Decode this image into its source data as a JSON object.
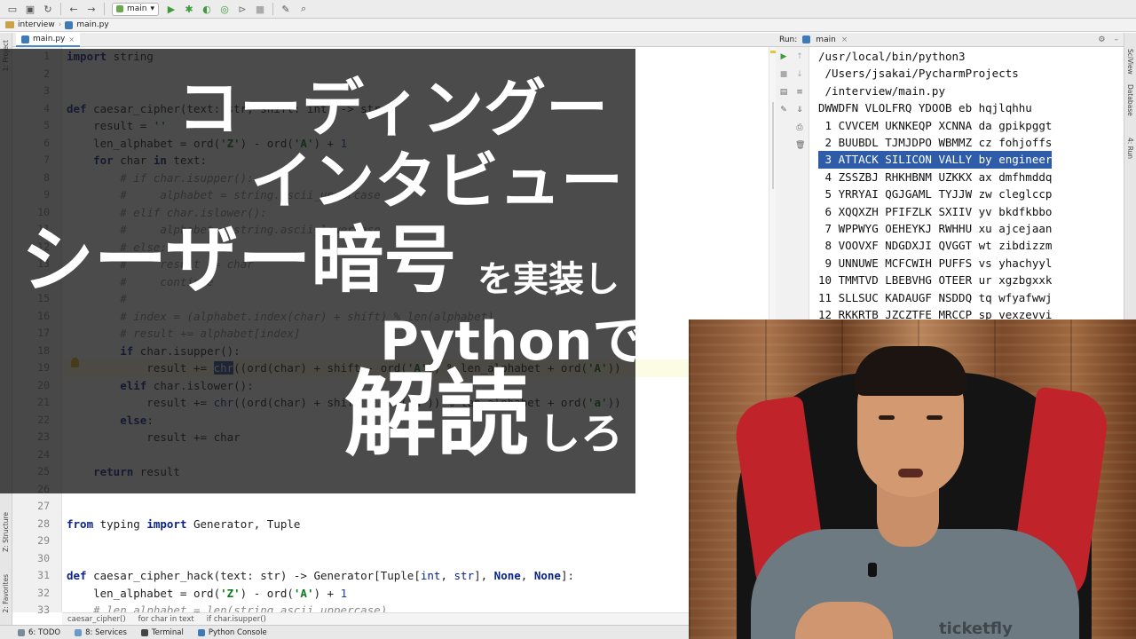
{
  "toolbar": {
    "run_config": "main"
  },
  "breadcrumb": {
    "project": "interview",
    "file": "main.py"
  },
  "left_stripe": {
    "project": "1: Project",
    "structure": "Z: Structure",
    "favorites": "2: Favorites"
  },
  "editor": {
    "tab": "main.py",
    "current_line": 19,
    "lines": [
      {
        "n": 1,
        "html": "<span class='kw'>import</span> string"
      },
      {
        "n": 2,
        "html": ""
      },
      {
        "n": 3,
        "html": ""
      },
      {
        "n": 4,
        "html": "<span class='kw'>def</span> caesar_cipher(text: str, shift: int) -> str:"
      },
      {
        "n": 5,
        "html": "    result = <span class='st'>''</span>"
      },
      {
        "n": 6,
        "html": "    len_alphabet = ord(<span class='st'>'Z'</span>) - ord(<span class='st'>'A'</span>) + <span class='nu'>1</span>"
      },
      {
        "n": 7,
        "html": "    <span class='kw'>for</span> char <span class='kw'>in</span> text:"
      },
      {
        "n": 8,
        "html": "        <span class='cm'># if char.isupper():</span>"
      },
      {
        "n": 9,
        "html": "        <span class='cm'>#     alphabet = string.ascii_uppercase</span>"
      },
      {
        "n": 10,
        "html": "        <span class='cm'># elif char.islower():</span>"
      },
      {
        "n": 11,
        "html": "        <span class='cm'>#     alphabet = string.ascii_lowercase</span>"
      },
      {
        "n": 12,
        "html": "        <span class='cm'># else:</span>"
      },
      {
        "n": 13,
        "html": "        <span class='cm'>#     result += char</span>"
      },
      {
        "n": 14,
        "html": "        <span class='cm'>#     continue</span>"
      },
      {
        "n": 15,
        "html": "        <span class='cm'>#</span>"
      },
      {
        "n": 16,
        "html": "        <span class='cm'># index = (alphabet.index(char) + shift) % len(alphabet)</span>"
      },
      {
        "n": 17,
        "html": "        <span class='cm'># result += alphabet[index]</span>"
      },
      {
        "n": 18,
        "html": "        <span class='kw'>if</span> char.isupper():"
      },
      {
        "n": 19,
        "html": "            result += <span class='sel'>chr</span>((ord(char) + shift - ord(<span class='st'>'A'</span>)) % len_alphabet + ord(<span class='st'>'A'</span>))"
      },
      {
        "n": 20,
        "html": "        <span class='kw'>elif</span> char.islower():"
      },
      {
        "n": 21,
        "html": "            result += <span class='bi'>chr</span>((ord(char) + shift - ord(<span class='st'>'a'</span>)) % len_alphabet + ord(<span class='st'>'a'</span>))"
      },
      {
        "n": 22,
        "html": "        <span class='kw'>else</span>:"
      },
      {
        "n": 23,
        "html": "            result += char"
      },
      {
        "n": 24,
        "html": ""
      },
      {
        "n": 25,
        "html": "    <span class='kw'>return</span> result"
      },
      {
        "n": 26,
        "html": ""
      },
      {
        "n": 27,
        "html": ""
      },
      {
        "n": 28,
        "html": "<span class='kw'>from</span> typing <span class='kw'>import</span> Generator, Tuple"
      },
      {
        "n": 29,
        "html": ""
      },
      {
        "n": 30,
        "html": ""
      },
      {
        "n": 31,
        "html": "<span class='kw'>def</span> caesar_cipher_hack(text: str) -> Generator[Tuple[<span class='bi'>int</span>, <span class='bi'>str</span>], <span class='kw'>None</span>, <span class='kw'>None</span>]:"
      },
      {
        "n": 32,
        "html": "    len_alphabet = ord(<span class='st'>'Z'</span>) - ord(<span class='st'>'A'</span>) + <span class='nu'>1</span>"
      },
      {
        "n": 33,
        "html": "    <span class='cm'># len_alphabet = len(string.ascii_uppercase)</span>"
      }
    ]
  },
  "overlay": {
    "line1": "コーディング",
    "line1b": "ー",
    "line2": "インタビュー",
    "line3": "シーザー暗号",
    "line3b": "を実装し",
    "line4": "Pythonで",
    "line5": "解読",
    "line5b": "しろ"
  },
  "run_panel": {
    "label": "Run:",
    "tab": "main",
    "output": [
      "/usr/local/bin/python3",
      " /Users/jsakai/PycharmProjects",
      " /interview/main.py",
      "DWWDFN VLOLFRQ YDOOB eb hqjlqhhu",
      " 1 CVVCEM UKNKEQP XCNNA da gpikpggt",
      " 2 BUUBDL TJMJDPO WBMMZ cz fohjoffs",
      " 3 ATTACK SILICON VALLY by engineer",
      " 4 ZSSZBJ RHKHBNM UZKKX ax dmfhmddq",
      " 5 YRRYAI QGJGAML TYJJW zw cleglccp",
      " 6 XQQXZH PFIFZLK SXIIV yv bkdfkbbo",
      " 7 WPPWYG OEHEYKJ RWHHU xu ajcejaan",
      " 8 VOOVXF NDGDXJI QVGGT wt zibdizzm",
      " 9 UNNUWE MCFCWIH PUFFS vs yhachyyl",
      "10 TMMTVD LBEBVHG OTEER ur xgzbgxxk",
      "11 SLLSUC KADAUGF NSDDQ tq wfyafwwj",
      "12 RKKRTB JZCZTFE MRCCP sp vexzevvi"
    ],
    "highlight_index": 6
  },
  "right_stripe": {
    "sciview": "SciView",
    "database": "Database",
    "run": "4: Run"
  },
  "code_crumbs": [
    "caesar_cipher()",
    "for char in text",
    "if char.isupper()"
  ],
  "bottom_tabs": [
    "6: TODO",
    "8: Services",
    "Terminal",
    "Python Console"
  ],
  "webcam": {
    "shirt_text": "ticketfly"
  }
}
